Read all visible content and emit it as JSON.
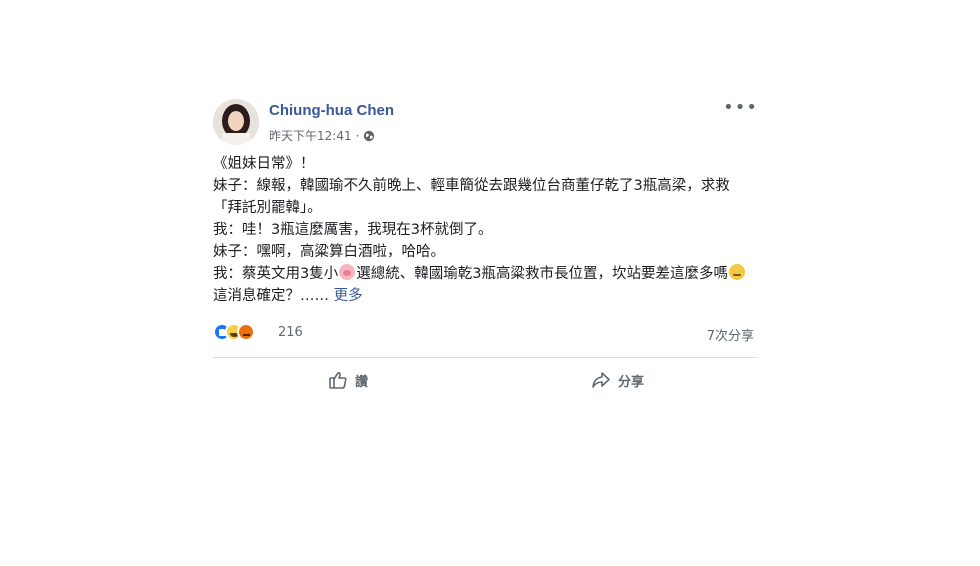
{
  "post": {
    "author": "Chiung-hua Chen",
    "timestamp": "昨天下午12:41",
    "separator": "·",
    "privacy_icon": "globe-icon",
    "more_label": "•••",
    "content": {
      "line1": "《姐妹日常》！",
      "line2": "妹子：線報，韓國瑜不久前晚上、輕車簡從去跟幾位台商董仔乾了3瓶高梁，求救「拜託別罷韓」。",
      "line3": "我：哇！3瓶這麼厲害，我現在3杯就倒了。",
      "line4": "妹子：嘿啊，高粱算白酒啦，哈哈。",
      "line5a": "我：蔡英文用3隻小",
      "line5_emoji": "pig-face-emoji",
      "line5b": "選總統、韓國瑜乾3瓶高粱救市長位置，坎站要差這麼多嗎",
      "line5_emoji2": "rolling-eyes-emoji",
      "line5c": "這消息確定？……",
      "see_more": "更多"
    },
    "reactions": {
      "icons": [
        "like-reaction-icon",
        "haha-reaction-icon",
        "angry-reaction-icon"
      ],
      "count": "216",
      "shares": "7次分享"
    },
    "actions": {
      "like_label": "讚",
      "share_label": "分享"
    }
  }
}
